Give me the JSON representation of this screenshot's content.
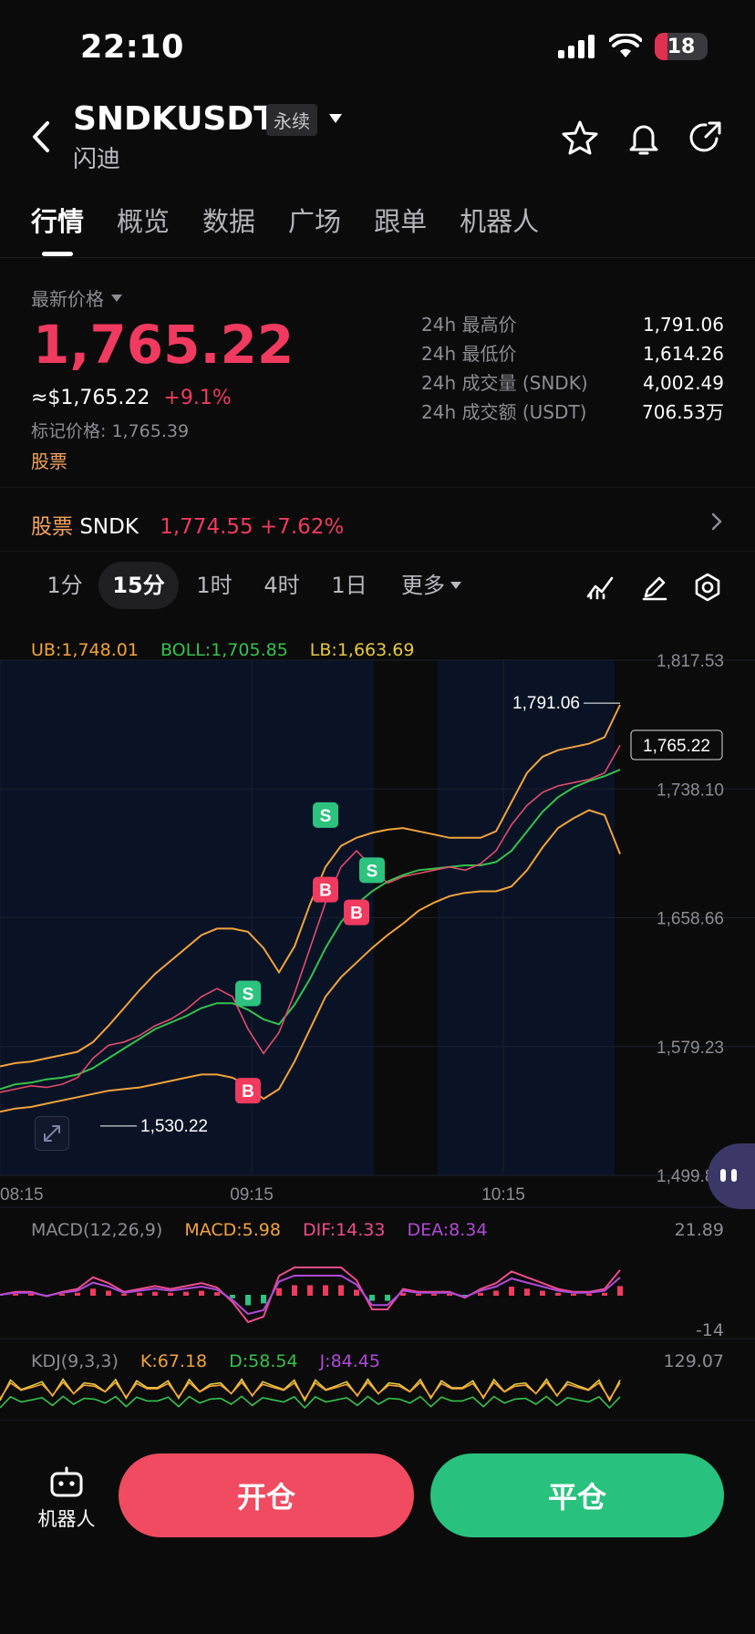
{
  "status_bar": {
    "time": "22:10",
    "battery": "18"
  },
  "header": {
    "title": "SNDKUSDT",
    "badge": "永续",
    "subtitle": "闪迪"
  },
  "tabs": [
    "行情",
    "概览",
    "数据",
    "广场",
    "跟单",
    "机器人"
  ],
  "price": {
    "label": "最新价格",
    "last": "1,765.22",
    "usd": "≈$1,765.22",
    "change": "+9.1%",
    "mark_label": "标记价格: ",
    "mark_value": "1,765.39",
    "stock_label": "股票"
  },
  "stats": [
    {
      "label": "24h 最高价",
      "value": "1,791.06"
    },
    {
      "label": "24h 最低价",
      "value": "1,614.26"
    },
    {
      "label": "24h 成交量 (SNDK)",
      "value": "4,002.49"
    },
    {
      "label": "24h 成交额 (USDT)",
      "value": "706.53万"
    }
  ],
  "stock_row": {
    "tag": "股票",
    "symbol": "SNDK",
    "price": "1,774.55",
    "change": "+7.62%"
  },
  "timeframes": {
    "items": [
      "1分",
      "15分",
      "1时",
      "4时",
      "1日"
    ],
    "more": "更多",
    "selected": "15分"
  },
  "indicators": {
    "boll": {
      "ub": "UB:1,748.01",
      "mid": "BOLL:1,705.85",
      "lb": "LB:1,663.69"
    },
    "macd": {
      "title": "MACD(12,26,9)",
      "macd": "MACD:5.98",
      "dif": "DIF:14.33",
      "dea": "DEA:8.34",
      "top": "21.89",
      "bottom": "-14"
    },
    "kdj": {
      "title": "KDJ(9,3,3)",
      "k": "K:67.18",
      "d": "D:58.54",
      "j": "J:84.45",
      "top": "129.07"
    }
  },
  "chart_data": {
    "type": "line",
    "title": "",
    "x_ticks": [
      "08:15",
      "09:15",
      "10:15"
    ],
    "y_ticks": [
      "1,817.53",
      "1,738.10",
      "1,658.66",
      "1,579.23",
      "1,499.80"
    ],
    "ylim": [
      1499.8,
      1817.53
    ],
    "high_label": "1,791.06",
    "low_label": "1,530.22",
    "current_label": "1,765.22",
    "series": [
      {
        "name": "BOLL",
        "color": "#35c24c",
        "values": [
          1553,
          1556,
          1557,
          1559,
          1560,
          1562,
          1566,
          1572,
          1578,
          1584,
          1590,
          1594,
          1598,
          1603,
          1606,
          1606,
          1602,
          1596,
          1593,
          1605,
          1621,
          1640,
          1656,
          1667,
          1675,
          1681,
          1685,
          1688,
          1689,
          1690,
          1691,
          1691,
          1693,
          1700,
          1712,
          1724,
          1733,
          1739,
          1743,
          1746,
          1750
        ]
      },
      {
        "name": "UB",
        "color": "#f2a33a",
        "values": [
          1567,
          1569,
          1570,
          1572,
          1574,
          1576,
          1582,
          1592,
          1603,
          1614,
          1624,
          1632,
          1640,
          1648,
          1652,
          1652,
          1650,
          1640,
          1625,
          1641,
          1667,
          1690,
          1703,
          1708,
          1711,
          1713,
          1714,
          1712,
          1710,
          1708,
          1708,
          1708,
          1712,
          1730,
          1748,
          1758,
          1762,
          1764,
          1766,
          1770,
          1790
        ]
      },
      {
        "name": "LB",
        "color": "#f2a33a",
        "values": [
          1539,
          1541,
          1542,
          1544,
          1546,
          1548,
          1550,
          1552,
          1553,
          1554,
          1556,
          1558,
          1560,
          1562,
          1562,
          1560,
          1555,
          1547,
          1553,
          1570,
          1590,
          1610,
          1622,
          1631,
          1640,
          1648,
          1655,
          1663,
          1668,
          1672,
          1674,
          1675,
          1675,
          1678,
          1688,
          1702,
          1714,
          1720,
          1725,
          1722,
          1698
        ]
      },
      {
        "name": "Price",
        "color": "#e24b6a",
        "values": [
          1551,
          1553,
          1555,
          1554,
          1556,
          1560,
          1572,
          1580,
          1582,
          1586,
          1592,
          1596,
          1602,
          1610,
          1615,
          1610,
          1590,
          1575,
          1588,
          1612,
          1640,
          1668,
          1690,
          1700,
          1690,
          1680,
          1684,
          1686,
          1688,
          1690,
          1688,
          1692,
          1700,
          1716,
          1728,
          1736,
          1740,
          1742,
          1744,
          1748,
          1765
        ]
      }
    ],
    "signals": [
      {
        "type": "S",
        "index": 16,
        "value": 1612
      },
      {
        "type": "B",
        "index": 16,
        "value": 1552
      },
      {
        "type": "S",
        "index": 21,
        "value": 1722
      },
      {
        "type": "B",
        "index": 21,
        "value": 1676
      },
      {
        "type": "S",
        "index": 24,
        "value": 1688
      },
      {
        "type": "B",
        "index": 23,
        "value": 1662
      }
    ]
  },
  "bottom": {
    "robot_label": "机器人",
    "open": "开仓",
    "close": "平仓"
  },
  "colors": {
    "red": "#f03a5f",
    "green": "#2cc37f",
    "accent": "#f2a33a"
  }
}
